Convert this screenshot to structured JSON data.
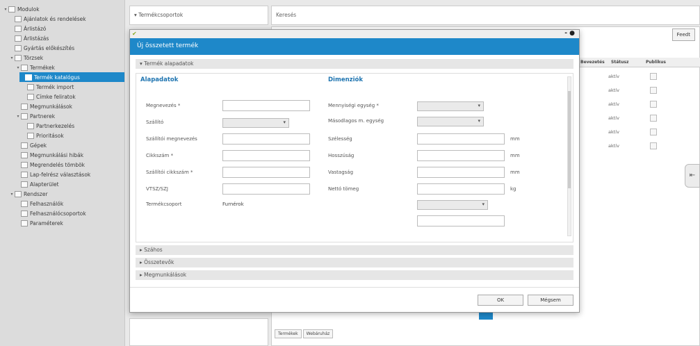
{
  "sidebar": {
    "items": [
      {
        "label": "Modulok",
        "toggle": "▾",
        "indent": 0
      },
      {
        "label": "Ajánlatok és rendelések",
        "toggle": "",
        "indent": 1
      },
      {
        "label": "Árlistázó",
        "toggle": "",
        "indent": 1
      },
      {
        "label": "Árlistázás",
        "toggle": "",
        "indent": 1
      },
      {
        "label": "Gyártás előkészítés",
        "toggle": "",
        "indent": 1
      },
      {
        "label": "Törzsek",
        "toggle": "▾",
        "indent": 1
      },
      {
        "label": "Termékek",
        "toggle": "▾",
        "indent": 2
      },
      {
        "label": "Termék katalógus",
        "toggle": "",
        "indent": 3,
        "selected": true
      },
      {
        "label": "Termék import",
        "toggle": "",
        "indent": 3
      },
      {
        "label": "Címke feliratok",
        "toggle": "",
        "indent": 3
      },
      {
        "label": "Megmunkálások",
        "toggle": "",
        "indent": 2
      },
      {
        "label": "Partnerek",
        "toggle": "▾",
        "indent": 2
      },
      {
        "label": "Partnerkezelés",
        "toggle": "",
        "indent": 3
      },
      {
        "label": "Prioritások",
        "toggle": "",
        "indent": 3
      },
      {
        "label": "Gépek",
        "toggle": "",
        "indent": 2
      },
      {
        "label": "Megmunkálási hibák",
        "toggle": "",
        "indent": 2
      },
      {
        "label": "Megrendelés tömbök",
        "toggle": "",
        "indent": 2
      },
      {
        "label": "Lap-felrész választások",
        "toggle": "",
        "indent": 2
      },
      {
        "label": "Alapterület",
        "toggle": "",
        "indent": 2
      },
      {
        "label": "Rendszer",
        "toggle": "▾",
        "indent": 1
      },
      {
        "label": "Felhasználók",
        "toggle": "",
        "indent": 2
      },
      {
        "label": "Felhasználócsoportok",
        "toggle": "",
        "indent": 2
      },
      {
        "label": "Paraméterek",
        "toggle": "",
        "indent": 2
      }
    ]
  },
  "topbar": {
    "product_groups": "▾ Termékcsoportok",
    "search_label": "Keresés"
  },
  "grid": {
    "new_button": "Feedt",
    "headers": [
      "Bevezetés",
      "Státusz",
      "Publikus"
    ],
    "rows": [
      {
        "status": "aktív"
      },
      {
        "status": "aktív"
      },
      {
        "status": "aktív"
      },
      {
        "status": "aktív"
      },
      {
        "status": "aktív"
      },
      {
        "status": "aktív"
      }
    ],
    "bottom_tabs": [
      "Termékek",
      "Webáruház"
    ]
  },
  "modal": {
    "title": "Új összetett termék",
    "section_basic": "▾ Termék alapadatok",
    "left_title": "Alapadatok",
    "right_title": "Dimenziók",
    "left_fields": {
      "megnevezes": "Megnevezés *",
      "szallito": "Szállító",
      "szallito_megnevezes": "Szállítói megnevezés",
      "cikkszam": "Cikkszám *",
      "szallitoi_cikkszam": "Szállítói cikkszám *",
      "vtsz": "VTSZ/SZJ",
      "termekcsoport": "Termékcsoport",
      "termekcsoport_value": "Furnérok"
    },
    "right_fields": {
      "mennyisegi_egyseg": "Mennyiségi egység *",
      "masodlagos": "Másodlagos m. egység",
      "szelesseg": "Szélesség",
      "hosszusag": "Hosszúság",
      "vastagsag": "Vastagság",
      "netto_tomeg": "Nettó tömeg",
      "unit_mm": "mm",
      "unit_kg": "kg"
    },
    "accordions": [
      "▸ Száhos",
      "▸ Összetevők",
      "▸ Megmunkálások"
    ],
    "ok_button": "OK",
    "cancel_button": "Mégsem"
  }
}
